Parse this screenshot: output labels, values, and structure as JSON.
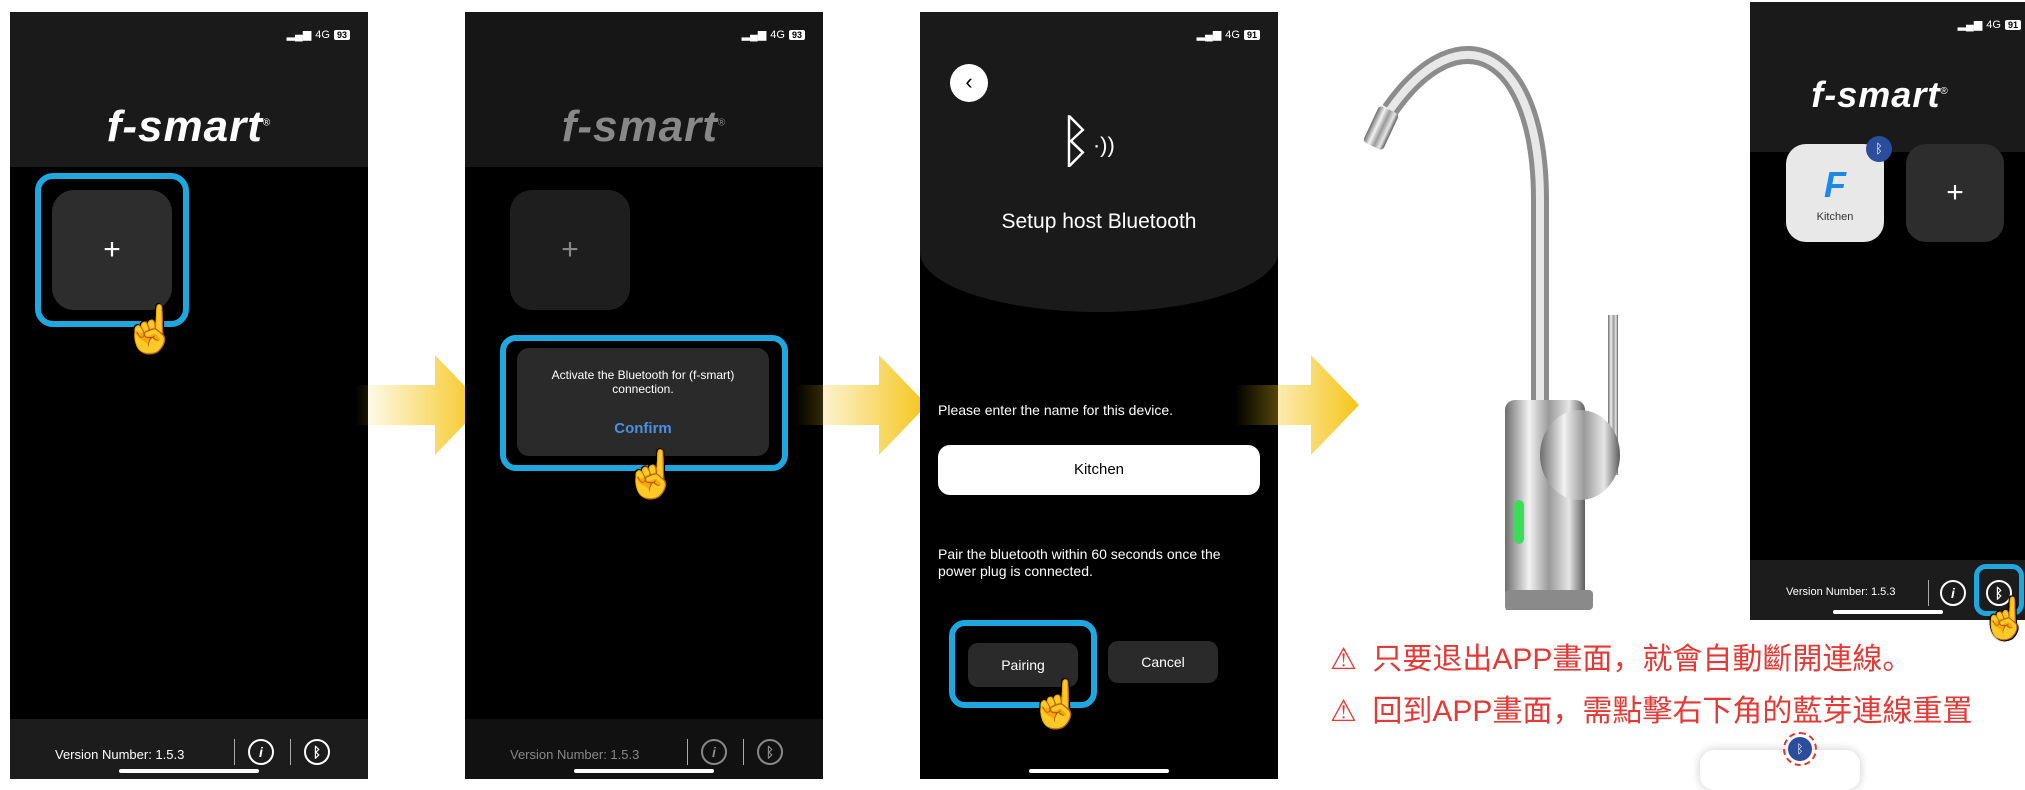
{
  "status": {
    "network": "4G",
    "battery_1": "93",
    "battery_2": "93",
    "battery_3": "91",
    "battery_5": "91"
  },
  "logo": {
    "text": "f-smart",
    "mark": "®"
  },
  "footer": {
    "version": "Version Number: 1.5.3"
  },
  "screen1": {
    "add_label": "+"
  },
  "screen2": {
    "add_label": "+",
    "dialog_text": "Activate the Bluetooth for (f-smart) connection.",
    "confirm_label": "Confirm"
  },
  "screen3": {
    "back_icon": "chevron-left-icon",
    "title": "Setup host Bluetooth",
    "name_prompt": "Please enter the name for this device.",
    "name_value": "Kitchen",
    "pair_hint": "Pair the bluetooth within 60 seconds once the power plug is connected.",
    "pairing_label": "Pairing",
    "cancel_label": "Cancel"
  },
  "screen5": {
    "device_label": "Kitchen",
    "add_label": "+",
    "version": "Version Number: 1.5.3"
  },
  "warnings": [
    "只要退出APP畫面，就會自動斷開連線。",
    "回到APP畫面，需點擊右下角的藍芽連線重置"
  ],
  "colors": {
    "highlight": "#1fa8e0",
    "arrow": "#f5c518",
    "warning": "#e53935",
    "confirm": "#4a90e2"
  }
}
